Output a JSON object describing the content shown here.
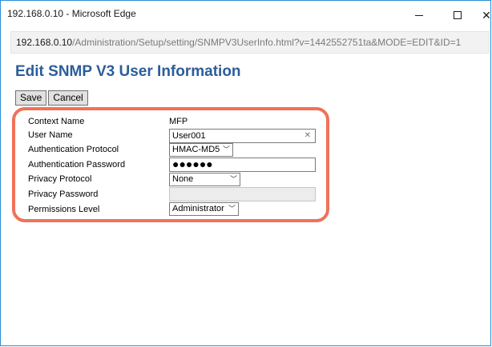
{
  "window": {
    "title": "192.168.0.10 - Microsoft Edge"
  },
  "address": {
    "host": "192.168.0.10",
    "path": "/Administration/Setup/setting/SNMPV3UserInfo.html?v=1442552751ta&MODE=EDIT&ID=1"
  },
  "page": {
    "title": "Edit SNMP V3 User Information",
    "save_label": "Save",
    "cancel_label": "Cancel"
  },
  "form": {
    "context_name": {
      "label": "Context Name",
      "value": "MFP"
    },
    "user_name": {
      "label": "User Name",
      "value": "User001"
    },
    "auth_protocol": {
      "label": "Authentication Protocol",
      "value": "HMAC-MD5"
    },
    "auth_password": {
      "label": "Authentication Password",
      "value": "●●●●●●"
    },
    "privacy_protocol": {
      "label": "Privacy Protocol",
      "value": "None"
    },
    "privacy_password": {
      "label": "Privacy Password",
      "value": ""
    },
    "permissions_level": {
      "label": "Permissions Level",
      "value": "Administrator"
    }
  },
  "colors": {
    "title_blue": "#2c5d9a",
    "highlight": "#f0715a",
    "window_border": "#2b8fd6"
  },
  "icons": {
    "minimize": "minimize-icon",
    "maximize": "maximize-icon",
    "close": "close-icon",
    "clear": "clear-icon",
    "dropdown": "chevron-down-icon"
  }
}
